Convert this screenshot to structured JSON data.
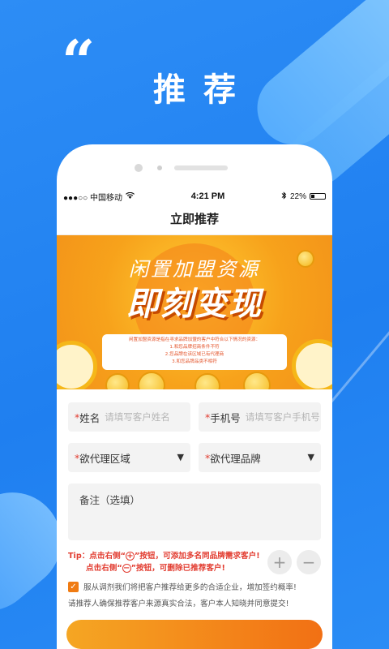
{
  "promo": {
    "quote_mark": "“",
    "headline": "推荐"
  },
  "status_bar": {
    "carrier": "●●●○○ 中国移动",
    "time": "4:21 PM",
    "battery": "22%"
  },
  "nav": {
    "title": "立即推荐"
  },
  "banner": {
    "line1": "闲置加盟资源",
    "line2": "即刻变现",
    "desc": "闲置加盟资源是指在寻求品牌加盟的客户中符合以下情况的资源：",
    "items": [
      "1.和您品牌招商条件不符",
      "2.您品牌在该区域已有代理商",
      "3.和您品牌品类不相符"
    ]
  },
  "form": {
    "name_label": "姓名",
    "name_placeholder": "请填写客户姓名",
    "phone_label": "手机号",
    "phone_placeholder": "请填写客户手机号",
    "region_label": "欲代理区域",
    "brand_label": "欲代理品牌",
    "notes_label": "备注（选填）",
    "required_mark": "*"
  },
  "tips": {
    "line1_a": "Tip：点击右侧“",
    "line1_b": "”按钮，可添加多名同品牌需求客户!",
    "line2_a": "点击右侧“",
    "line2_b": "”按钮，可删除已推荐客户!",
    "plus": "+",
    "minus": "−"
  },
  "agreement": {
    "text": "服从调剂我们将把客户推荐给更多的合适企业，增加签约概率!",
    "note": "请推荐人确保推荐客户来源真实合法，客户本人知晓并同意提交!"
  },
  "icons": {
    "check": "✓",
    "caret": "▼",
    "wifi": "wifi-icon",
    "bluetooth": "bluetooth-icon"
  },
  "colors": {
    "accent": "#f27014",
    "primary_bg": "#1f7ff0",
    "required": "#e23c30"
  }
}
